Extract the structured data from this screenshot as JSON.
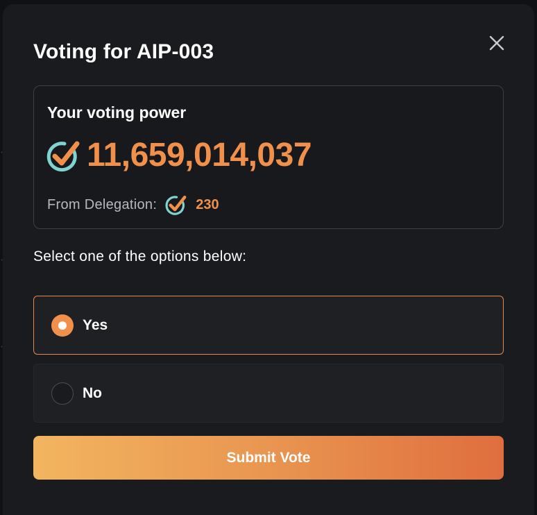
{
  "modal": {
    "title": "Voting for AIP-003",
    "close_icon": "close-icon"
  },
  "voting_power": {
    "label": "Your voting power",
    "value": "11,659,014,037",
    "icon": "checkmark-badge-icon",
    "delegation_label": "From Delegation:",
    "delegation_value": "230"
  },
  "options": {
    "instruction": "Select one of the options below:",
    "items": [
      {
        "label": "Yes",
        "selected": true
      },
      {
        "label": "No",
        "selected": false
      }
    ]
  },
  "submit": {
    "label": "Submit Vote"
  },
  "colors": {
    "accent": "#f0904a",
    "modal_bg": "#1a1b1f",
    "card_border": "#3d3f46",
    "selected_border": "#e58a4a",
    "gradient_start": "#f2b55f",
    "gradient_end": "#df6e3e"
  }
}
